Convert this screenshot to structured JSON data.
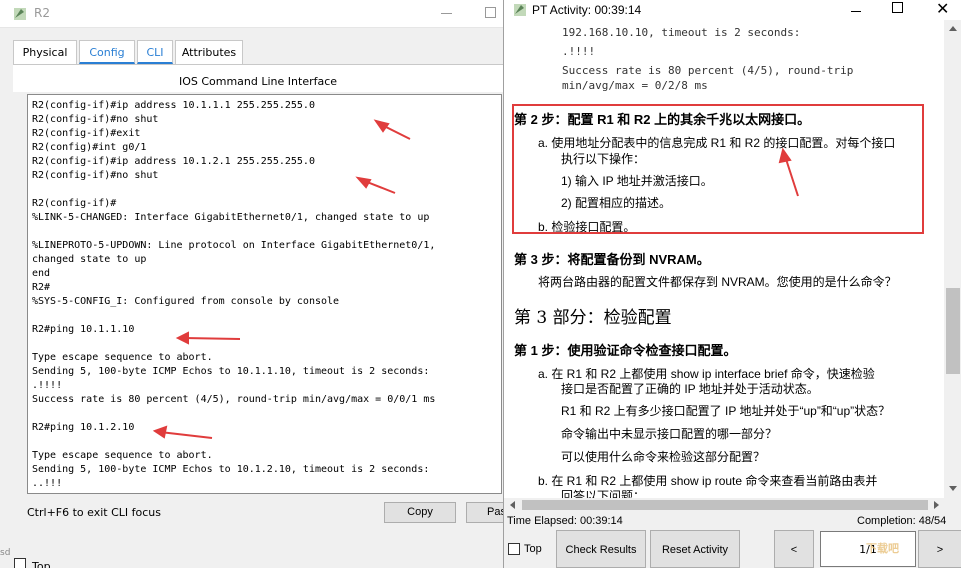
{
  "r2_window": {
    "title": "R2",
    "tabs": [
      "Physical",
      "Config",
      "CLI",
      "Attributes"
    ],
    "cli_header": "IOS Command Line Interface",
    "cli_lines": [
      "R2(config-if)#ip address 10.1.1.1 255.255.255.0",
      "R2(config-if)#no shut",
      "R2(config-if)#exit",
      "R2(config)#int g0/1",
      "R2(config-if)#ip address 10.1.2.1 255.255.255.0",
      "R2(config-if)#no shut",
      "",
      "R2(config-if)#",
      "%LINK-5-CHANGED: Interface GigabitEthernet0/1, changed state to up",
      "",
      "%LINEPROTO-5-UPDOWN: Line protocol on Interface GigabitEthernet0/1,",
      "changed state to up",
      "end",
      "R2#",
      "%SYS-5-CONFIG_I: Configured from console by console",
      "",
      "R2#ping 10.1.1.10",
      "",
      "Type escape sequence to abort.",
      "Sending 5, 100-byte ICMP Echos to 10.1.1.10, timeout is 2 seconds:",
      ".!!!!",
      "Success rate is 80 percent (4/5), round-trip min/avg/max = 0/0/1 ms",
      "",
      "R2#ping 10.1.2.10",
      "",
      "Type escape sequence to abort.",
      "Sending 5, 100-byte ICMP Echos to 10.1.2.10, timeout is 2 seconds:",
      "..!!!"
    ],
    "hint": "Ctrl+F6 to exit CLI focus",
    "copy_label": "Copy",
    "paste_label": "Paste",
    "top_label": "Top",
    "edge_text": "sd"
  },
  "pt_window": {
    "title": "PT Activity: 00:39:14",
    "prev_output": [
      "192.168.10.10, timeout is 2 seconds:",
      ".!!!!",
      "Success rate is 80 percent (4/5), round-trip",
      "min/avg/max = 0/2/8 ms"
    ],
    "step2_title": "第 2 步：配置 R1 和 R2 上的其余千兆以太网接口。",
    "step2_a1": "a.  使用地址分配表中的信息完成 R1 和 R2 的接口配置。对每个接口",
    "step2_a2": "执行以下操作：",
    "step2_a_1": "1)  输入 IP 地址并激活接口。",
    "step2_a_2": "2)  配置相应的描述。",
    "step2_b": "b.  检验接口配置。",
    "step3_title": "第 3 步：将配置备份到 NVRAM。",
    "step3_body": "将两台路由器的配置文件都保存到 NVRAM。您使用的是什么命令？",
    "part3_title": "第 3 部分：检验配置",
    "p3_step1_title": "第 1 步：使用验证命令检查接口配置。",
    "p3_a1": "a.  在 R1 和 R2 上都使用 show ip interface brief 命令，快速检验",
    "p3_a2": "接口是否配置了正确的 IP 地址并处于活动状态。",
    "p3_q1": "R1 和 R2 上有多少接口配置了 IP 地址并处于“up”和“up”状态？",
    "p3_q2": "命令输出中未显示接口配置的哪一部分？",
    "p3_q3": "可以使用什么命令来检验这部分配置？",
    "p3_b1": "b.  在 R1 和 R2 上都使用 show ip route 命令来查看当前路由表并",
    "p3_b2": "回答以下问题：",
    "time_elapsed": "Time Elapsed: 00:39:14",
    "completion": "Completion: 48/54",
    "top_label": "Top",
    "check_results": "Check Results",
    "reset_activity": "Reset Activity",
    "prev_btn": "<",
    "page": "1/1",
    "next_btn": ">"
  },
  "watermark": "下载吧",
  "colors": {
    "accent": "#2a7fd4",
    "highlight_box": "#e03c3c",
    "arrow": "#e03c3c"
  }
}
